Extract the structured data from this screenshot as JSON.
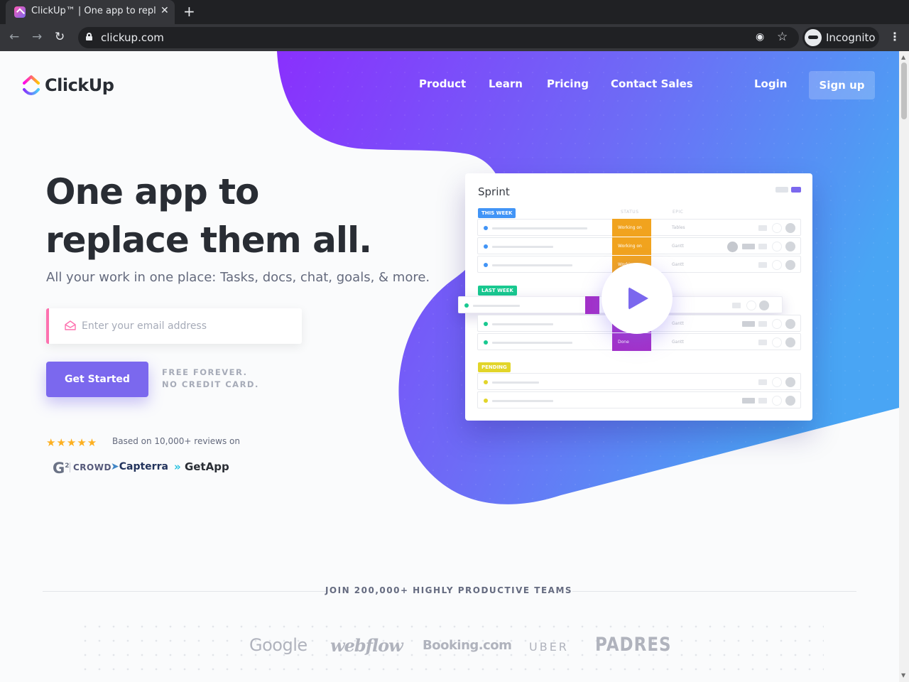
{
  "browser": {
    "tab_title": "ClickUp™ | One app to replace them all",
    "url": "clickup.com",
    "profile_label": "Incognito",
    "close_glyph": "✕",
    "new_tab_glyph": "+",
    "back_glyph": "←",
    "forward_glyph": "→",
    "reload_glyph": "↻",
    "star_glyph": "☆",
    "eye_glyph": "◉",
    "menu_glyph": "⋮"
  },
  "site": {
    "logo_text": "ClickUp",
    "nav": {
      "product": "Product",
      "learn": "Learn",
      "pricing": "Pricing",
      "contact": "Contact Sales",
      "login": "Login",
      "signup": "Sign up"
    },
    "hero": {
      "title_line1": "One app to",
      "title_line2": "replace them all.",
      "subtitle": "All your work in one place: Tasks, docs, chat, goals, & more.",
      "email_placeholder": "Enter your email address",
      "cta": "Get Started",
      "free_line1": "FREE FOREVER.",
      "free_line2": "NO CREDIT CARD."
    },
    "reviews": {
      "stars": "★★★★★",
      "rating": 5,
      "text": "Based on 10,000+ reviews on",
      "g2_mark": "G",
      "g2_sup": "2",
      "g2_text": "CROWD",
      "capterra_arrow": "➤",
      "capterra": "Capterra",
      "getapp_arrow": "»",
      "getapp": "GetApp"
    },
    "mockup": {
      "title": "Sprint",
      "col_status": "STATUS",
      "col_epic": "EPIC",
      "this_week": "THIS WEEK",
      "last_week": "LAST WEEK",
      "pending": "PENDING",
      "rows_this_week": [
        {
          "status": "Working on",
          "epic": "Tables"
        },
        {
          "status": "Working on",
          "epic": "Gantt"
        },
        {
          "status": "Working on",
          "epic": "Gantt"
        }
      ],
      "rows_last_week": [
        {
          "status": "",
          "epic": ""
        },
        {
          "status": "",
          "epic": "Gantt"
        },
        {
          "status": "Done",
          "epic": "Gantt"
        }
      ],
      "colors": {
        "this_week": "#4194f6",
        "last_week": "#19c990",
        "pending": "#e2d52a",
        "working_on": "#f1a31e",
        "done": "#a330c8",
        "accent": "#7b68ee"
      }
    },
    "teams": {
      "heading": "JOIN 200,000+ HIGHLY PRODUCTIVE TEAMS",
      "brands": [
        "Google",
        "webflow",
        "Booking.com",
        "UBER",
        "PADRES"
      ]
    }
  }
}
